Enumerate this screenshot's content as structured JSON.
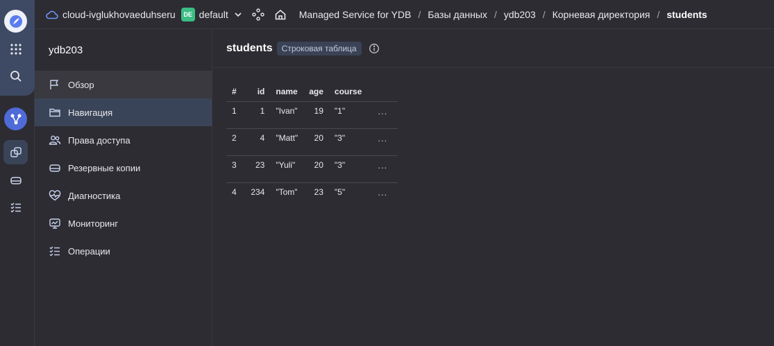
{
  "header": {
    "cloud_name": "cloud-ivglukhovaeduhseru",
    "folder_badge": "DE",
    "folder_name": "default",
    "breadcrumbs": [
      {
        "label": "Managed Service for YDB"
      },
      {
        "label": "Базы данных"
      },
      {
        "label": "ydb203"
      },
      {
        "label": "Корневая директория"
      },
      {
        "label": "students"
      }
    ],
    "separator": "/"
  },
  "sidebar": {
    "title": "ydb203",
    "items": [
      {
        "label": "Обзор",
        "icon": "flag-icon"
      },
      {
        "label": "Навигация",
        "icon": "folder-icon"
      },
      {
        "label": "Права доступа",
        "icon": "users-icon"
      },
      {
        "label": "Резервные копии",
        "icon": "backup-drive-icon"
      },
      {
        "label": "Диагностика",
        "icon": "heartbeat-icon"
      },
      {
        "label": "Мониторинг",
        "icon": "monitor-chart-icon"
      },
      {
        "label": "Операции",
        "icon": "operations-list-icon"
      }
    ]
  },
  "main": {
    "title": "students",
    "type_tag": "Строковая таблица",
    "table": {
      "columns": [
        "#",
        "id",
        "name",
        "age",
        "course"
      ],
      "rows": [
        {
          "index": "1",
          "id": "1",
          "name": "\"Ivan\"",
          "age": "19",
          "course": "\"1\""
        },
        {
          "index": "2",
          "id": "4",
          "name": "\"Matt\"",
          "age": "20",
          "course": "\"3\""
        },
        {
          "index": "3",
          "id": "23",
          "name": "\"Yuli\"",
          "age": "20",
          "course": "\"3\""
        },
        {
          "index": "4",
          "id": "234",
          "name": "\"Tom\"",
          "age": "23",
          "course": "\"5\""
        }
      ],
      "row_action": "..."
    }
  },
  "colors": {
    "background": "#2d2c33",
    "accent_blue": "#4da3ff",
    "folder_badge": "#3bbd84",
    "selected_nav": "#3a4459"
  }
}
